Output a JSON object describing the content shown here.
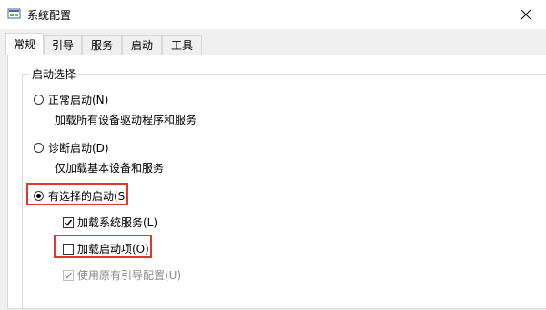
{
  "window": {
    "title": "系统配置"
  },
  "tabs": [
    {
      "label": "常规",
      "active": true
    },
    {
      "label": "引导",
      "active": false
    },
    {
      "label": "服务",
      "active": false
    },
    {
      "label": "启动",
      "active": false
    },
    {
      "label": "工具",
      "active": false
    }
  ],
  "startup_selection": {
    "legend": "启动选择",
    "normal": {
      "label": "正常启动(N)",
      "description": "加载所有设备驱动程序和服务",
      "selected": false
    },
    "diagnostic": {
      "label": "诊断启动(D)",
      "description": "仅加载基本设备和服务",
      "selected": false
    },
    "selective": {
      "label": "有选择的启动(S)",
      "selected": true,
      "options": {
        "load_system_services": {
          "label": "加载系统服务(L)",
          "checked": true,
          "enabled": true
        },
        "load_startup_items": {
          "label": "加载启动项(O)",
          "checked": false,
          "enabled": true
        },
        "use_original_boot_config": {
          "label": "使用原有引导配置(U)",
          "checked": true,
          "enabled": false
        }
      }
    }
  },
  "colors": {
    "highlight": "#e0392c",
    "panel": "#ffffff",
    "window_bg": "#f0f0f0"
  }
}
